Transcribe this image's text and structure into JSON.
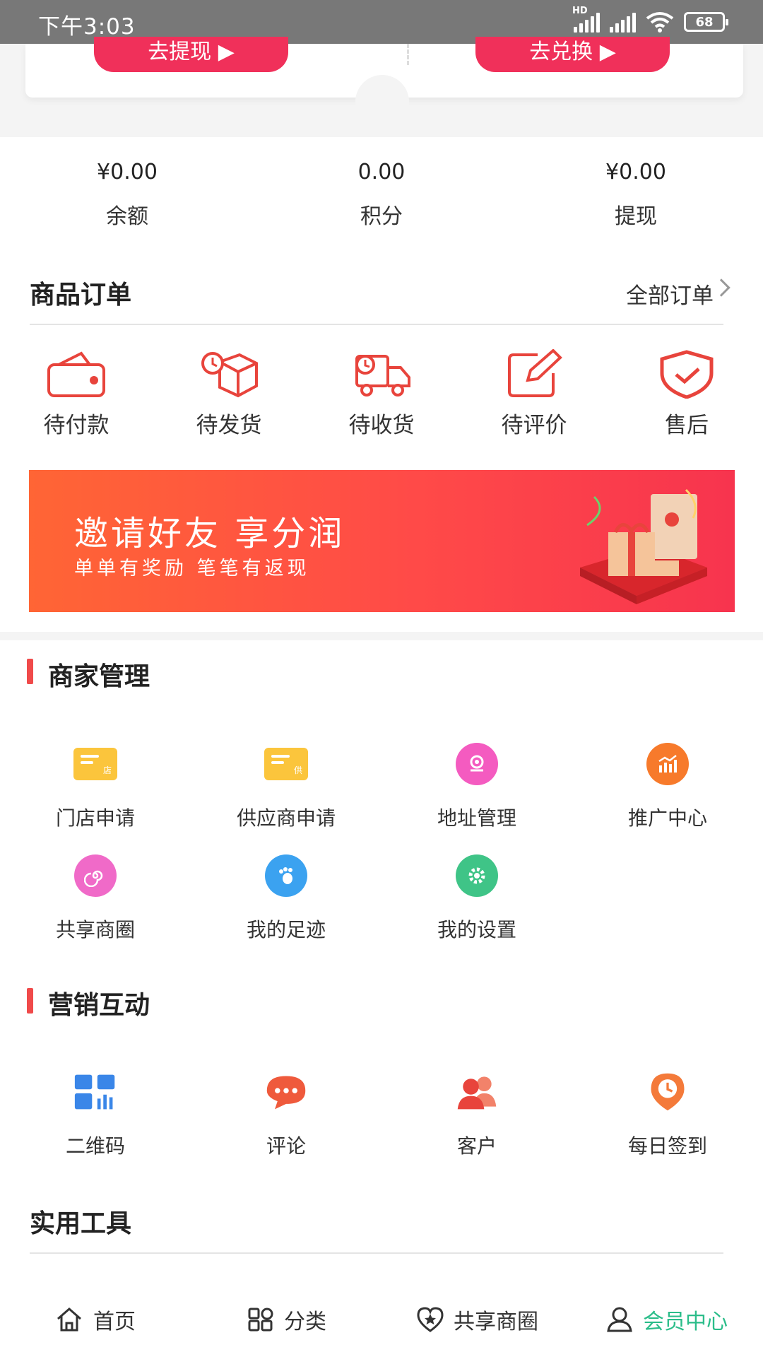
{
  "status_bar": {
    "time": "下午3:03",
    "battery": "68",
    "hd": "HD"
  },
  "top_card": {
    "withdraw_button": "去提现 ▶",
    "exchange_button": "去兑换 ▶"
  },
  "stats": [
    {
      "value": "¥0.00",
      "label": "余额"
    },
    {
      "value": "0.00",
      "label": "积分"
    },
    {
      "value": "¥0.00",
      "label": "提现"
    }
  ],
  "orders": {
    "title": "商品订单",
    "all_link": "全部订单",
    "items": [
      {
        "label": "待付款",
        "icon": "wallet-icon"
      },
      {
        "label": "待发货",
        "icon": "package-icon"
      },
      {
        "label": "待收货",
        "icon": "truck-icon"
      },
      {
        "label": "待评价",
        "icon": "edit-icon"
      },
      {
        "label": "售后",
        "icon": "shield-icon"
      }
    ]
  },
  "banner": {
    "title": "邀请好友 享分润",
    "subtitle": "单单有奖励 笔笔有返现"
  },
  "merchant": {
    "title": "商家管理",
    "items": [
      {
        "label": "门店申请",
        "icon": "store-card-icon",
        "badge": "店"
      },
      {
        "label": "供应商申请",
        "icon": "supplier-card-icon",
        "badge": "供"
      },
      {
        "label": "地址管理",
        "icon": "location-icon"
      },
      {
        "label": "推广中心",
        "icon": "chart-icon"
      },
      {
        "label": "共享商圈",
        "icon": "spiral-icon"
      },
      {
        "label": "我的足迹",
        "icon": "footprint-icon"
      },
      {
        "label": "我的设置",
        "icon": "settings-icon"
      }
    ]
  },
  "marketing": {
    "title": "营销互动",
    "items": [
      {
        "label": "二维码",
        "icon": "qrcode-icon"
      },
      {
        "label": "评论",
        "icon": "comment-icon"
      },
      {
        "label": "客户",
        "icon": "customers-icon"
      },
      {
        "label": "每日签到",
        "icon": "checkin-icon"
      }
    ]
  },
  "tools": {
    "title": "实用工具"
  },
  "bottom_nav": [
    {
      "label": "首页",
      "icon": "home-icon"
    },
    {
      "label": "分类",
      "icon": "category-icon"
    },
    {
      "label": "共享商圈",
      "icon": "star-heart-icon"
    },
    {
      "label": "会员中心",
      "icon": "user-icon",
      "active": true
    }
  ],
  "colors": {
    "accent": "#f0305a",
    "active_nav": "#2bbd8a",
    "section_bar": "#f04a4a",
    "icon_red": "#e8443c"
  }
}
